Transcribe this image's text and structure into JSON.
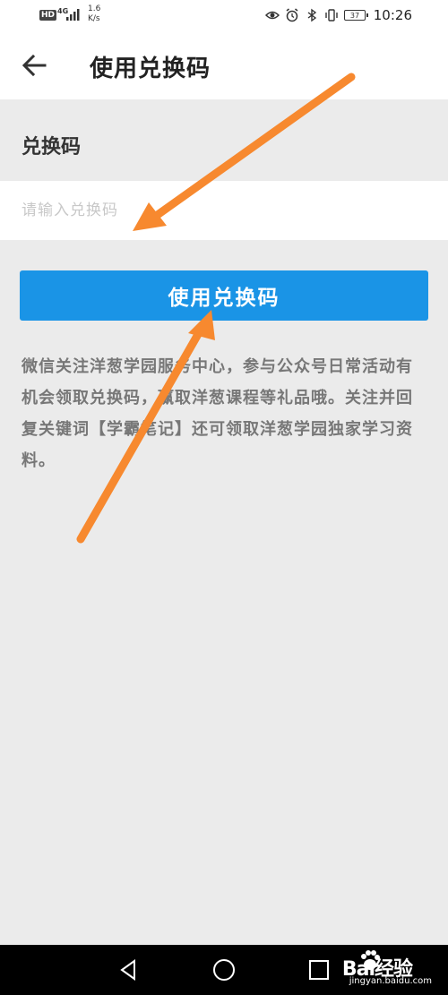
{
  "status_bar": {
    "hd": "HD",
    "network": "4G",
    "speed": "1.6\nK/s",
    "battery": "37",
    "time": "10:26"
  },
  "app_bar": {
    "title": "使用兑换码"
  },
  "form": {
    "label": "兑换码",
    "placeholder": "请输入兑换码",
    "value": ""
  },
  "button": {
    "label": "使用兑换码"
  },
  "description": "微信关注洋葱学园服务中心，参与公众号日常活动有机会领取兑换码，赢取洋葱课程等礼品哦。关注并回复关键词【学霸笔记】还可领取洋葱学园独家学习资料。",
  "watermark": {
    "logo": "Bai经验",
    "url": "jingyan.baidu.com"
  },
  "colors": {
    "accent": "#1a94e6",
    "annotation_arrow": "#f7892f",
    "background": "#ebebeb"
  },
  "icons": {
    "back": "arrow-left-icon",
    "nav_back": "triangle-back-icon",
    "nav_home": "circle-home-icon",
    "nav_recent": "square-recent-icon"
  }
}
